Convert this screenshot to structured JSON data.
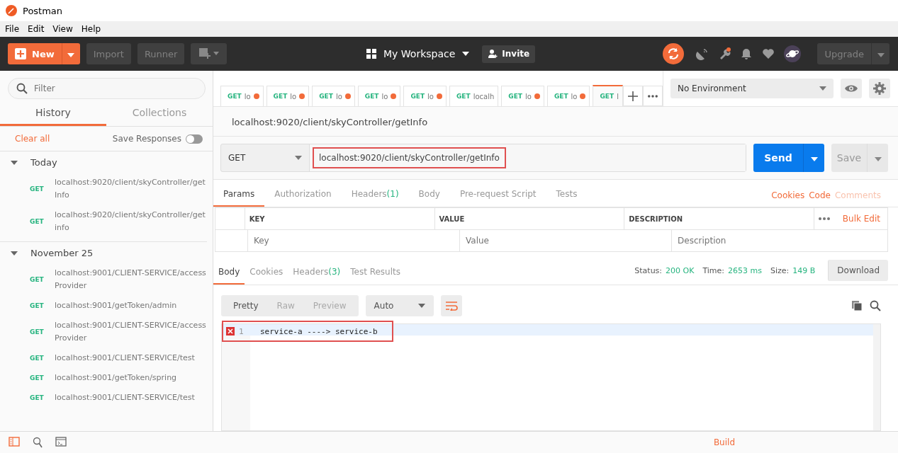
{
  "window": {
    "title": "Postman"
  },
  "menu": [
    "File",
    "Edit",
    "View",
    "Help"
  ],
  "toolbar": {
    "new": "New",
    "import": "Import",
    "runner": "Runner",
    "workspace": "My Workspace",
    "invite": "Invite",
    "upgrade": "Upgrade",
    "notification_dot": true
  },
  "sidebar": {
    "filter_placeholder": "Filter",
    "tabs": [
      {
        "label": "History",
        "selected": true
      },
      {
        "label": "Collections",
        "selected": false
      }
    ],
    "clear_all": "Clear all",
    "save_responses": {
      "label": "Save Responses",
      "on": false
    },
    "groups": [
      {
        "title": "Today",
        "expanded": true,
        "items": [
          {
            "method": "GET",
            "url": "localhost:9020/client/skyController/getInfo"
          },
          {
            "method": "GET",
            "url": "localhost:9020/client/skyController/getinfo"
          }
        ]
      },
      {
        "title": "November 25",
        "expanded": true,
        "items": [
          {
            "method": "GET",
            "url": "localhost:9001/CLIENT-SERVICE/accessProvider"
          },
          {
            "method": "GET",
            "url": "localhost:9001/getToken/admin"
          },
          {
            "method": "GET",
            "url": "localhost:9001/CLIENT-SERVICE/accessProvider"
          },
          {
            "method": "GET",
            "url": "localhost:9001/CLIENT-SERVICE/test"
          },
          {
            "method": "GET",
            "url": "localhost:9001/getToken/spring"
          },
          {
            "method": "GET",
            "url": "localhost:9001/CLIENT-SERVICE/test"
          }
        ]
      }
    ]
  },
  "request_tabs": [
    {
      "method": "GET",
      "label": "lo",
      "unsaved": true,
      "selected": false
    },
    {
      "method": "GET",
      "label": "lo",
      "unsaved": true,
      "selected": false
    },
    {
      "method": "GET",
      "label": "lo",
      "unsaved": true,
      "selected": false
    },
    {
      "method": "GET",
      "label": "lo",
      "unsaved": true,
      "selected": false
    },
    {
      "method": "GET",
      "label": "lo",
      "unsaved": true,
      "selected": false
    },
    {
      "method": "GET",
      "label": "localh",
      "unsaved": false,
      "selected": false
    },
    {
      "method": "GET",
      "label": "lo",
      "unsaved": true,
      "selected": false
    },
    {
      "method": "GET",
      "label": "lo",
      "unsaved": true,
      "selected": false
    },
    {
      "method": "GET",
      "label": "l",
      "unsaved": false,
      "selected": true
    }
  ],
  "environment": {
    "value": "No Environment"
  },
  "request": {
    "title": "localhost:9020/client/skyController/getInfo",
    "method": "GET",
    "url": "localhost:9020/client/skyController/getInfo",
    "url_highlighted": true,
    "send": "Send",
    "save": "Save"
  },
  "request_sections": [
    {
      "label": "Params",
      "selected": true
    },
    {
      "label": "Authorization",
      "selected": false
    },
    {
      "label": "Headers",
      "count": "(1)",
      "selected": false
    },
    {
      "label": "Body",
      "selected": false
    },
    {
      "label": "Pre-request Script",
      "selected": false
    },
    {
      "label": "Tests",
      "selected": false
    }
  ],
  "request_links": [
    {
      "label": "Cookies",
      "disabled": false
    },
    {
      "label": "Code",
      "disabled": false
    },
    {
      "label": "Comments",
      "disabled": true
    }
  ],
  "params_table": {
    "columns": [
      "KEY",
      "VALUE",
      "DESCRIPTION"
    ],
    "bulk_edit": "Bulk Edit",
    "placeholders": [
      "Key",
      "Value",
      "Description"
    ]
  },
  "response_sections": [
    {
      "label": "Body",
      "selected": true
    },
    {
      "label": "Cookies",
      "selected": false
    },
    {
      "label": "Headers",
      "count": "(3)",
      "selected": false
    },
    {
      "label": "Test Results",
      "selected": false
    }
  ],
  "response_meta": [
    {
      "label": "Status:",
      "value": "200 OK"
    },
    {
      "label": "Time:",
      "value": "2653 ms"
    },
    {
      "label": "Size:",
      "value": "149 B"
    }
  ],
  "download": "Download",
  "view_modes": [
    {
      "label": "Pretty",
      "selected": true
    },
    {
      "label": "Raw",
      "selected": false
    },
    {
      "label": "Preview",
      "selected": false
    }
  ],
  "format": "Auto",
  "code_lines": [
    {
      "number": "1",
      "text": "service-a ----> service-b",
      "error": true,
      "highlighted": true
    }
  ],
  "status_bar": {
    "build": "Build"
  }
}
